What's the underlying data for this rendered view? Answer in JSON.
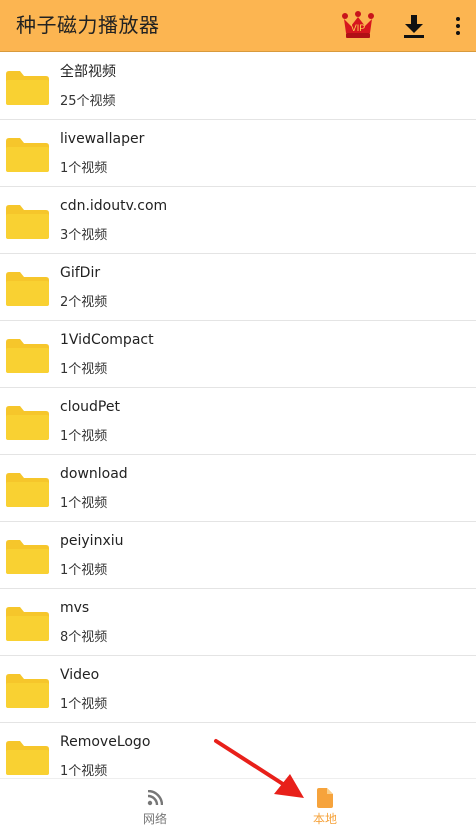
{
  "app_bar": {
    "title": "种子磁力播放器",
    "vip_badge": "VIP",
    "icons": {
      "vip": "crown-vip-icon",
      "download": "download-icon",
      "more": "more-vert-icon"
    }
  },
  "folders": [
    {
      "name": "全部视频",
      "count": "25个视频"
    },
    {
      "name": "livewallaper",
      "count": "1个视频"
    },
    {
      "name": "cdn.idoutv.com",
      "count": "3个视频"
    },
    {
      "name": "GifDir",
      "count": "2个视频"
    },
    {
      "name": "1VidCompact",
      "count": "1个视频"
    },
    {
      "name": "cloudPet",
      "count": "1个视频"
    },
    {
      "name": "download",
      "count": "1个视频"
    },
    {
      "name": "peiyinxiu",
      "count": "1个视频"
    },
    {
      "name": "mvs",
      "count": "8个视频"
    },
    {
      "name": "Video",
      "count": "1个视频"
    },
    {
      "name": "RemoveLogo",
      "count": "1个视频"
    }
  ],
  "bottom_nav": {
    "tabs": [
      {
        "label": "网络",
        "icon": "rss-feed-icon",
        "active": false
      },
      {
        "label": "本地",
        "icon": "document-icon",
        "active": true
      }
    ]
  },
  "colors": {
    "app_bar": "#fcb551",
    "folder": "#f6c62b",
    "active_tab": "#f6a33c",
    "annotation_arrow": "#e8201a"
  }
}
